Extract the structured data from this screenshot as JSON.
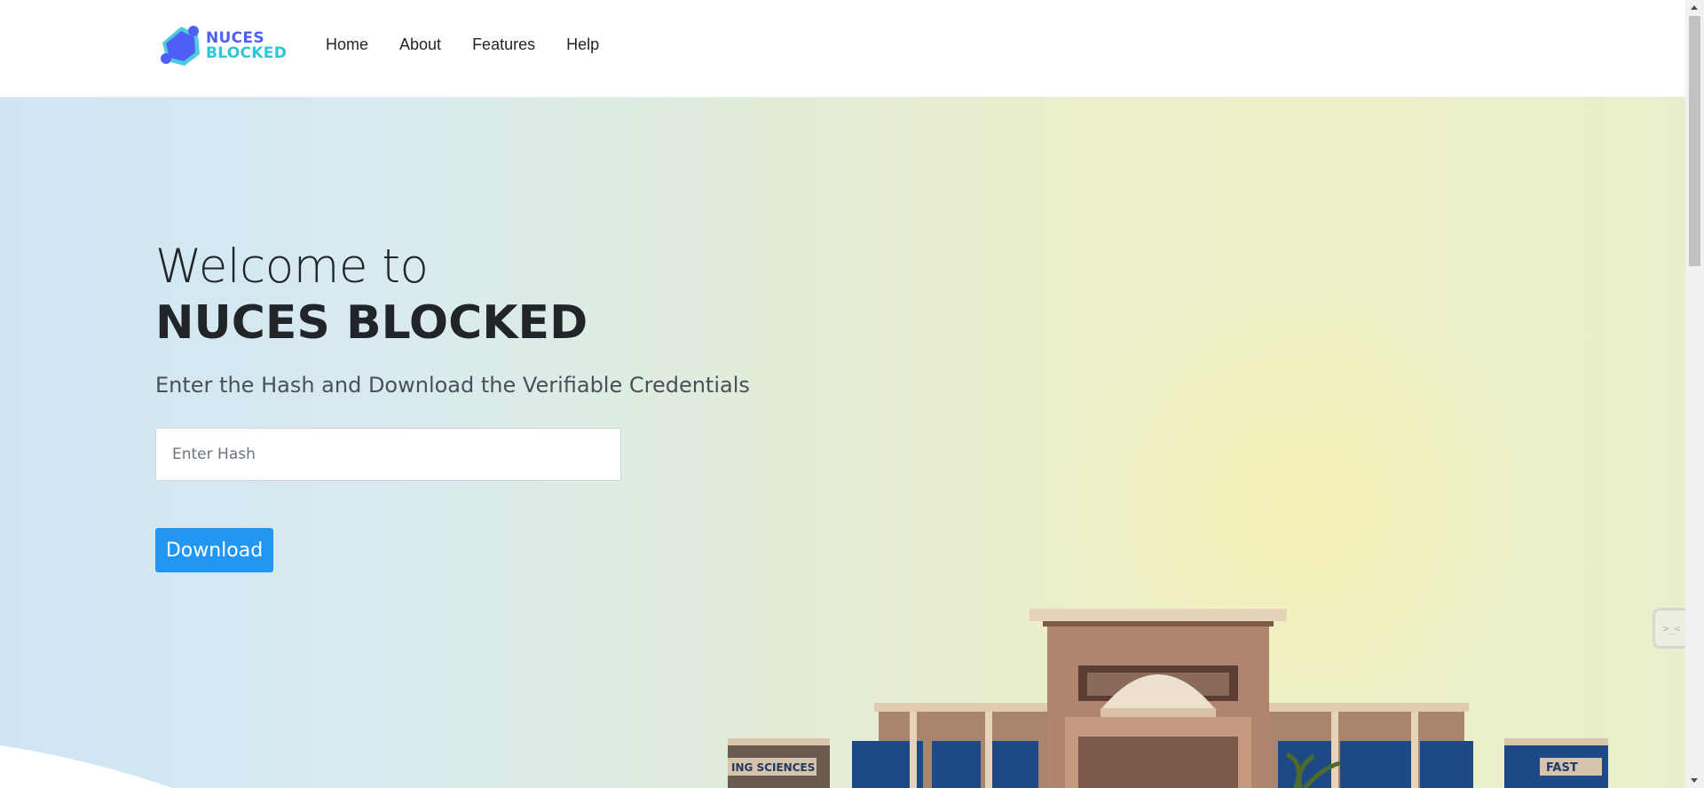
{
  "header": {
    "logo": {
      "line1": "NUCES",
      "line2": "BLOCKED"
    },
    "nav": [
      "Home",
      "About",
      "Features",
      "Help"
    ]
  },
  "hero": {
    "welcome": "Welcome to",
    "title": "NUCES BLOCKED",
    "subtitle": "Enter the Hash and Download the Verifiable Credentials",
    "hash_input": {
      "placeholder": "Enter Hash",
      "value": ""
    },
    "download_label": "Download",
    "building_signs": {
      "left": "ING SCIENCES",
      "right": "FAST"
    }
  },
  "side_widget": {
    "label": ">_<"
  },
  "colors": {
    "accent": "#2196f3",
    "logo_primary": "#4f5ef5",
    "logo_secondary": "#2fc5d9",
    "text": "#212529"
  }
}
